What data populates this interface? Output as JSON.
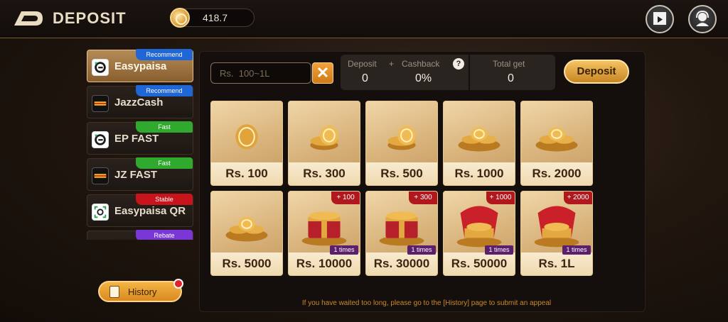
{
  "header": {
    "title": "DEPOSIT",
    "balance": "418.7"
  },
  "sidebar": {
    "items": [
      {
        "label": "Easypaisa",
        "badge": "Recommend",
        "badge_color": "#1f66d6",
        "icon": "easypaisa-icon",
        "active": true
      },
      {
        "label": "JazzCash",
        "badge": "Recommend",
        "badge_color": "#1f66d6",
        "icon": "jazzcash-icon",
        "active": false
      },
      {
        "label": "EP FAST",
        "badge": "Fast",
        "badge_color": "#2faa2f",
        "icon": "easypaisa-icon",
        "active": false
      },
      {
        "label": "JZ FAST",
        "badge": "Fast",
        "badge_color": "#2faa2f",
        "icon": "jazzcash-icon",
        "active": false
      },
      {
        "label": "Easypaisa QR",
        "badge": "Stable",
        "badge_color": "#c8141b",
        "icon": "qr-icon",
        "active": false
      },
      {
        "label": "",
        "badge": "Rebate",
        "badge_color": "#7a37d8",
        "icon": "easypaisa-icon",
        "active": false
      }
    ],
    "history_label": "History"
  },
  "deposit_form": {
    "placeholder": "Rs.  100~1L",
    "deposit_label": "Deposit",
    "plus": "+",
    "cashback_label": "Cashback",
    "help": "?",
    "deposit_value": "0",
    "cashback_value": "0%",
    "total_label": "Total get",
    "total_value": "0",
    "button": "Deposit",
    "clear": "✕"
  },
  "tiles": [
    {
      "price": "Rs. 100",
      "bonus": "",
      "times": "",
      "art": "single-coin"
    },
    {
      "price": "Rs. 300",
      "bonus": "",
      "times": "",
      "art": "coin-stack"
    },
    {
      "price": "Rs. 500",
      "bonus": "",
      "times": "",
      "art": "coin-stack"
    },
    {
      "price": "Rs. 1000",
      "bonus": "",
      "times": "",
      "art": "coin-pile"
    },
    {
      "price": "Rs. 2000",
      "bonus": "",
      "times": "",
      "art": "coin-pile"
    },
    {
      "price": "Rs. 5000",
      "bonus": "",
      "times": "",
      "art": "coin-pile"
    },
    {
      "price": "Rs. 10000",
      "bonus": "+ 100",
      "times": "1 times",
      "art": "treasure-chest"
    },
    {
      "price": "Rs. 30000",
      "bonus": "+ 300",
      "times": "1 times",
      "art": "treasure-chest"
    },
    {
      "price": "Rs. 50000",
      "bonus": "+ 1000",
      "times": "1 times",
      "art": "red-chest"
    },
    {
      "price": "Rs. 1L",
      "bonus": "+ 2000",
      "times": "1 times",
      "art": "red-chest"
    }
  ],
  "footer": "If you have waited too long, please go to the [History] page to submit an appeal"
}
